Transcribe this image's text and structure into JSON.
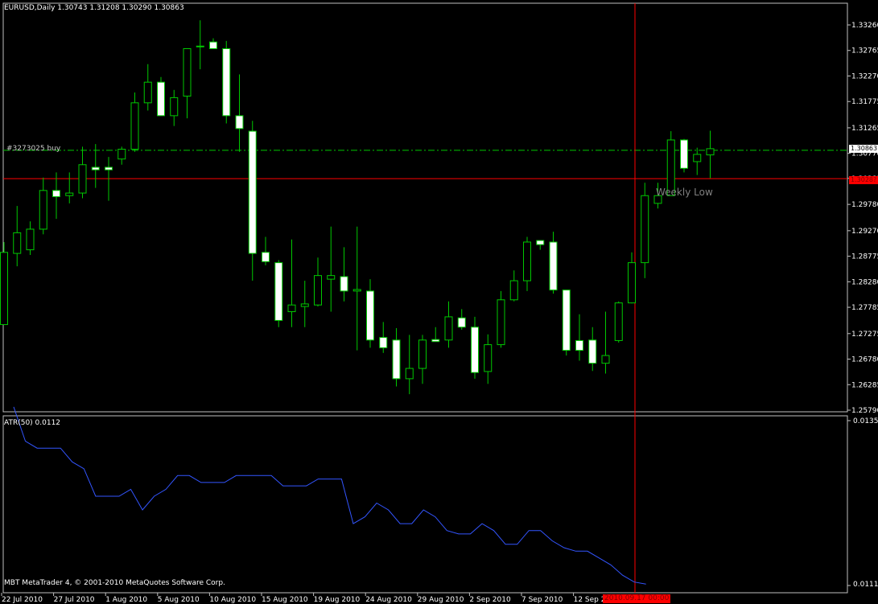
{
  "header": {
    "title": "EURUSD,Daily  1.30743 1.31208 1.30290 1.30863"
  },
  "indicator": {
    "label": "ATR(50) 0.0112",
    "axis_top": "0.0135",
    "axis_bottom": "0.0111"
  },
  "order_label": "#3273025 buy",
  "weekly_low_label": "Weekly Low",
  "current_price": "1.30863",
  "crosshair_price": "1.3028?",
  "crosshair_time": "2010.09.17 00:00",
  "footer": "MBT MetaTrader 4, © 2001-2010 MetaQuotes Software Corp.",
  "colors": {
    "background": "#000000",
    "bull_candle": "#000000",
    "bear_candle": "#ffffff",
    "wick": "#00c800",
    "atr_line": "#3355ff",
    "crosshair": "#ff0000",
    "order_line": "#00c800"
  },
  "chart_data": [
    {
      "type": "candlestick",
      "symbol": "EURUSD",
      "timeframe": "Daily",
      "ylim": [
        1.2579,
        1.3371
      ],
      "y_ticks": [
        "1.33260",
        "1.32765",
        "1.32270",
        "1.31775",
        "1.31265",
        "1.30770",
        "1.30285",
        "1.29780",
        "1.29270",
        "1.28775",
        "1.28280",
        "1.27785",
        "1.27275",
        "1.26780",
        "1.26285",
        "1.25790"
      ],
      "x_ticks": [
        "22 Jul 2010",
        "27 Jul 2010",
        "1 Aug 2010",
        "5 Aug 2010",
        "10 Aug 2010",
        "15 Aug 2010",
        "19 Aug 2010",
        "24 Aug 2010",
        "29 Aug 2010",
        "2 Sep 2010",
        "7 Sep 2010",
        "12 Sep 20"
      ],
      "order_line_price": 1.3083,
      "crosshair_price": 1.3028,
      "candles": [
        {
          "o": 1.2745,
          "h": 1.2905,
          "l": 1.2745,
          "c": 1.2885
        },
        {
          "o": 1.2883,
          "h": 1.2975,
          "l": 1.2858,
          "c": 1.2923
        },
        {
          "o": 1.289,
          "h": 1.2945,
          "l": 1.288,
          "c": 1.293
        },
        {
          "o": 1.293,
          "h": 1.303,
          "l": 1.292,
          "c": 1.3005
        },
        {
          "o": 1.3005,
          "h": 1.304,
          "l": 1.295,
          "c": 1.2993
        },
        {
          "o": 1.2995,
          "h": 1.304,
          "l": 1.298,
          "c": 1.3
        },
        {
          "o": 1.3,
          "h": 1.309,
          "l": 1.299,
          "c": 1.3055
        },
        {
          "o": 1.305,
          "h": 1.3095,
          "l": 1.301,
          "c": 1.3045
        },
        {
          "o": 1.305,
          "h": 1.307,
          "l": 1.2985,
          "c": 1.3045
        },
        {
          "o": 1.3066,
          "h": 1.309,
          "l": 1.3055,
          "c": 1.3085
        },
        {
          "o": 1.3085,
          "h": 1.3195,
          "l": 1.308,
          "c": 1.3175
        },
        {
          "o": 1.3175,
          "h": 1.325,
          "l": 1.316,
          "c": 1.3215
        },
        {
          "o": 1.3215,
          "h": 1.3225,
          "l": 1.315,
          "c": 1.315
        },
        {
          "o": 1.315,
          "h": 1.32,
          "l": 1.313,
          "c": 1.3185
        },
        {
          "o": 1.3188,
          "h": 1.325,
          "l": 1.3145,
          "c": 1.328
        },
        {
          "o": 1.3285,
          "h": 1.3335,
          "l": 1.324,
          "c": 1.3285
        },
        {
          "o": 1.3293,
          "h": 1.33,
          "l": 1.328,
          "c": 1.328
        },
        {
          "o": 1.328,
          "h": 1.3295,
          "l": 1.3135,
          "c": 1.315
        },
        {
          "o": 1.315,
          "h": 1.323,
          "l": 1.308,
          "c": 1.3125
        },
        {
          "o": 1.312,
          "h": 1.314,
          "l": 1.283,
          "c": 1.2883
        },
        {
          "o": 1.2885,
          "h": 1.2915,
          "l": 1.286,
          "c": 1.2867
        },
        {
          "o": 1.2865,
          "h": 1.287,
          "l": 1.274,
          "c": 1.2753
        },
        {
          "o": 1.277,
          "h": 1.291,
          "l": 1.274,
          "c": 1.2783
        },
        {
          "o": 1.278,
          "h": 1.283,
          "l": 1.274,
          "c": 1.2785
        },
        {
          "o": 1.2783,
          "h": 1.2875,
          "l": 1.278,
          "c": 1.284
        },
        {
          "o": 1.2833,
          "h": 1.2935,
          "l": 1.277,
          "c": 1.284
        },
        {
          "o": 1.2838,
          "h": 1.2895,
          "l": 1.279,
          "c": 1.281
        },
        {
          "o": 1.281,
          "h": 1.2935,
          "l": 1.2695,
          "c": 1.2813
        },
        {
          "o": 1.281,
          "h": 1.2833,
          "l": 1.27,
          "c": 1.2715
        },
        {
          "o": 1.272,
          "h": 1.275,
          "l": 1.269,
          "c": 1.27
        },
        {
          "o": 1.2715,
          "h": 1.2738,
          "l": 1.2625,
          "c": 1.264
        },
        {
          "o": 1.264,
          "h": 1.2725,
          "l": 1.261,
          "c": 1.266
        },
        {
          "o": 1.266,
          "h": 1.2725,
          "l": 1.263,
          "c": 1.2715
        },
        {
          "o": 1.2716,
          "h": 1.274,
          "l": 1.2712,
          "c": 1.2712
        },
        {
          "o": 1.2715,
          "h": 1.279,
          "l": 1.27,
          "c": 1.276
        },
        {
          "o": 1.2758,
          "h": 1.2775,
          "l": 1.2735,
          "c": 1.274
        },
        {
          "o": 1.274,
          "h": 1.276,
          "l": 1.264,
          "c": 1.2652
        },
        {
          "o": 1.2654,
          "h": 1.2726,
          "l": 1.263,
          "c": 1.2706
        },
        {
          "o": 1.2706,
          "h": 1.281,
          "l": 1.27,
          "c": 1.2793
        },
        {
          "o": 1.2793,
          "h": 1.285,
          "l": 1.279,
          "c": 1.283
        },
        {
          "o": 1.283,
          "h": 1.2915,
          "l": 1.281,
          "c": 1.2905
        },
        {
          "o": 1.2908,
          "h": 1.2908,
          "l": 1.289,
          "c": 1.29
        },
        {
          "o": 1.2905,
          "h": 1.2925,
          "l": 1.2805,
          "c": 1.2812
        },
        {
          "o": 1.2812,
          "h": 1.2805,
          "l": 1.2685,
          "c": 1.2695
        },
        {
          "o": 1.2714,
          "h": 1.2765,
          "l": 1.2675,
          "c": 1.2695
        },
        {
          "o": 1.2715,
          "h": 1.274,
          "l": 1.2655,
          "c": 1.267
        },
        {
          "o": 1.267,
          "h": 1.277,
          "l": 1.265,
          "c": 1.2685
        },
        {
          "o": 1.2714,
          "h": 1.279,
          "l": 1.271,
          "c": 1.2787
        },
        {
          "o": 1.2787,
          "h": 1.2885,
          "l": 1.2786,
          "c": 1.2865
        },
        {
          "o": 1.2865,
          "h": 1.302,
          "l": 1.2835,
          "c": 1.2995
        },
        {
          "o": 1.298,
          "h": 1.302,
          "l": 1.297,
          "c": 1.2995
        },
        {
          "o": 1.2995,
          "h": 1.312,
          "l": 1.2995,
          "c": 1.3103
        },
        {
          "o": 1.3103,
          "h": 1.3105,
          "l": 1.304,
          "c": 1.3048
        },
        {
          "o": 1.3061,
          "h": 1.3088,
          "l": 1.3035,
          "c": 1.3075
        },
        {
          "o": 1.3074,
          "h": 1.3121,
          "l": 1.3029,
          "c": 1.3086
        }
      ]
    },
    {
      "type": "line",
      "name": "ATR(50) 0.0112",
      "ylim": [
        0.0111,
        0.0135
      ],
      "values": [
        0.0137,
        0.0132,
        0.0131,
        0.0131,
        0.0131,
        0.0129,
        0.0128,
        0.0124,
        0.0124,
        0.0124,
        0.0125,
        0.0122,
        0.0124,
        0.0125,
        0.0127,
        0.0127,
        0.0126,
        0.0126,
        0.0126,
        0.0127,
        0.0127,
        0.0127,
        0.0127,
        0.01255,
        0.01255,
        0.01255,
        0.01265,
        0.01265,
        0.01265,
        0.012,
        0.0121,
        0.0123,
        0.0122,
        0.012,
        0.012,
        0.0122,
        0.0121,
        0.0119,
        0.01185,
        0.01185,
        0.012,
        0.0119,
        0.0117,
        0.0117,
        0.0119,
        0.0119,
        0.01175,
        0.01165,
        0.0116,
        0.0116,
        0.0115,
        0.0114,
        0.01125,
        0.01115,
        0.01112
      ]
    }
  ]
}
